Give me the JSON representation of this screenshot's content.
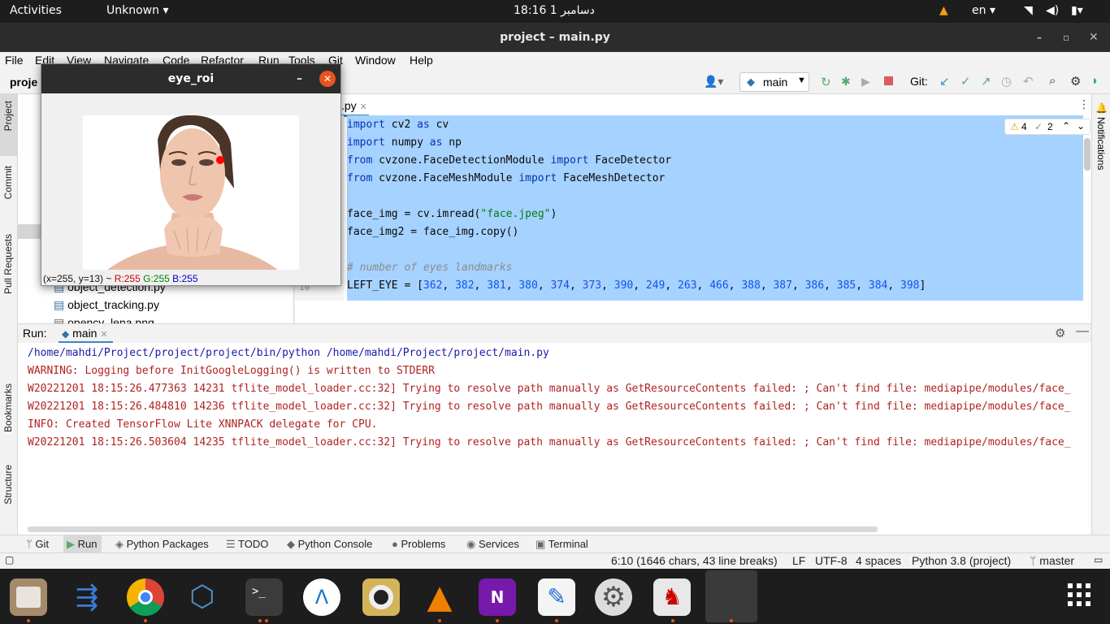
{
  "topbar": {
    "activities": "Activities",
    "app": "Unknown",
    "clock": "18:16 دسامبر 1",
    "lang": "en"
  },
  "window": {
    "title": "project – main.py"
  },
  "menu": [
    "File",
    "Edit",
    "View",
    "Navigate",
    "Code",
    "Refactor",
    "Run",
    "Tools",
    "Git",
    "Window",
    "Help"
  ],
  "toolbar": {
    "project_label": "proje",
    "run_config": "main",
    "git_label": "Git:"
  },
  "left_tabs": [
    "Project",
    "Commit",
    "Pull Requests",
    "Bookmarks",
    "Structure"
  ],
  "right_tabs": [
    "Notifications"
  ],
  "project_tree": {
    "items": [
      "object_detection.py",
      "object_tracking.py",
      "opencv_lena.png"
    ]
  },
  "editor": {
    "tab": "main.py",
    "tab_visible": ".py",
    "warnings": "4",
    "weak_warnings": "2",
    "line_number_visible": "10",
    "lines": [
      {
        "type": "import",
        "kw1": "import",
        "mod": " cv2 ",
        "kw2": "as",
        "alias": " cv"
      },
      {
        "type": "import",
        "kw1": "import",
        "mod": " numpy ",
        "kw2": "as",
        "alias": " np"
      },
      {
        "type": "from",
        "kw1": "from",
        "mod": " cvzone.FaceDetectionModule ",
        "kw2": "import",
        "alias": " FaceDetector"
      },
      {
        "type": "from",
        "kw1": "from",
        "mod": " cvzone.FaceMeshModule ",
        "kw2": "import",
        "alias": " FaceMeshDetector"
      },
      {
        "type": "blank"
      },
      {
        "type": "assign_str",
        "pre": "face_img = cv.imread(",
        "str": "\"face.jpeg\"",
        "post": ")"
      },
      {
        "type": "plain",
        "text": "face_img2 = face_img.copy()"
      },
      {
        "type": "blank"
      },
      {
        "type": "comment",
        "text": "# number of eyes landmarks"
      },
      {
        "type": "list",
        "pre": "LEFT_EYE = [",
        "nums": [
          "362",
          "382",
          "381",
          "380",
          "374",
          "373",
          "390",
          "249",
          "263",
          "466",
          "388",
          "387",
          "386",
          "385",
          "384",
          "398"
        ],
        "post": "]"
      }
    ]
  },
  "run": {
    "label": "Run:",
    "tab": "main",
    "lines": [
      {
        "text": "/home/mahdi/Project/project/project/bin/python /home/mahdi/Project/project/main.py",
        "color": "#1a1aa6"
      },
      {
        "text": "WARNING: Logging before InitGoogleLogging() is written to STDERR",
        "color": "#b22222"
      },
      {
        "text": "W20221201 18:15:26.477363 14231 tflite_model_loader.cc:32] Trying to resolve path manually as GetResourceContents failed: ; Can't find file: mediapipe/modules/face_",
        "color": "#b22222"
      },
      {
        "text": "W20221201 18:15:26.484810 14236 tflite_model_loader.cc:32] Trying to resolve path manually as GetResourceContents failed: ; Can't find file: mediapipe/modules/face_",
        "color": "#b22222"
      },
      {
        "text": "INFO: Created TensorFlow Lite XNNPACK delegate for CPU.",
        "color": "#b22222"
      },
      {
        "text": "W20221201 18:15:26.503604 14235 tflite_model_loader.cc:32] Trying to resolve path manually as GetResourceContents failed: ; Can't find file: mediapipe/modules/face_",
        "color": "#b22222"
      }
    ]
  },
  "bottom_tabs": [
    "Git",
    "Run",
    "Python Packages",
    "TODO",
    "Python Console",
    "Problems",
    "Services",
    "Terminal"
  ],
  "status": {
    "position": "6:10 (1646 chars, 43 line breaks)",
    "line_sep": "LF",
    "encoding": "UTF-8",
    "indent": "4 spaces",
    "interpreter": "Python 3.8 (project)",
    "branch": "master"
  },
  "eye_window": {
    "title": "eye_roi",
    "coords": "(x=255, y=13) ~ ",
    "r": "R:255",
    "g": "G:255",
    "b": "B:255"
  },
  "colors": {
    "selection": "#a6d2ff",
    "accent_orange": "#e95420",
    "close_button": "#e95420"
  }
}
